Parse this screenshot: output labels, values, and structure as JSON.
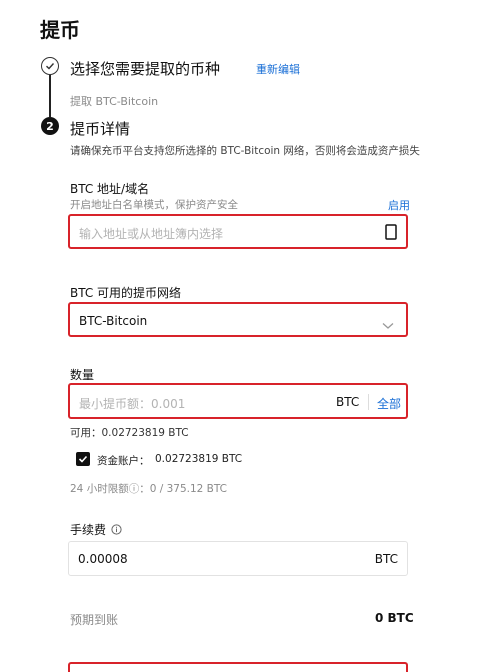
{
  "page": {
    "title": "提币"
  },
  "step1": {
    "title": "选择您需要提取的币种",
    "edit_link": "重新编辑",
    "summary": "提取 BTC-Bitcoin"
  },
  "step2": {
    "number": "2",
    "title": "提币详情",
    "notice": "请确保充币平台支持您所选择的 BTC-Bitcoin 网络，否则将会造成资产损失"
  },
  "address": {
    "label": "BTC 地址/域名",
    "whitelist_hint": "开启地址白名单模式，保护资产安全",
    "enable_link": "启用",
    "placeholder": "输入地址或从地址簿内选择"
  },
  "network": {
    "label": "BTC 可用的提币网络",
    "selected": "BTC-Bitcoin"
  },
  "amount": {
    "label": "数量",
    "placeholder": "最小提币额：0.001",
    "unit": "BTC",
    "all_button": "全部",
    "available": "可用：0.02723819 BTC",
    "fund_account_label": "资金账户：",
    "fund_account_value": "0.02723819 BTC",
    "fund_account_checked": true,
    "limit_24h": "24 小时限额ⓘ：0 / 375.12 BTC"
  },
  "fee": {
    "label": "手续费",
    "value": "0.00008",
    "unit": "BTC"
  },
  "expected": {
    "label": "预期到账",
    "value": "0 BTC"
  },
  "colors": {
    "accent_link": "#1a6fd6",
    "highlight_border": "#d8232a"
  }
}
